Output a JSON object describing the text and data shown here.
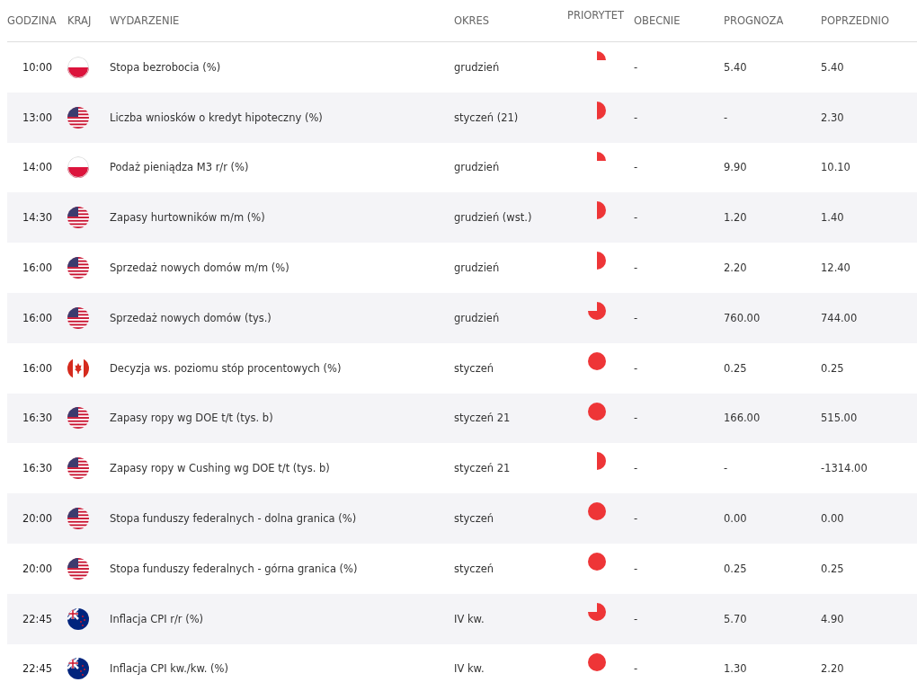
{
  "table": {
    "columns": [
      "GODZINA",
      "KRAJ",
      "WYDARZENIE",
      "OKRES",
      "PRIORYTET",
      "OBECNIE",
      "PROGNOZA",
      "POPRZEDNIO"
    ],
    "rows": [
      {
        "time": "10:00",
        "country": {
          "kind": "pl"
        },
        "event": "Stopa bezrobocia (%)",
        "period": "grudzień",
        "priority": {
          "kind": "quarter"
        },
        "actual": "-",
        "forecast": "5.40",
        "previous": "5.40"
      },
      {
        "time": "13:00",
        "country": {
          "kind": "us"
        },
        "event": "Liczba wniosków o kredyt hipoteczny (%)",
        "period": "styczeń (21)",
        "priority": {
          "kind": "half"
        },
        "actual": "-",
        "forecast": "-",
        "previous": "2.30"
      },
      {
        "time": "14:00",
        "country": {
          "kind": "pl"
        },
        "event": "Podaż pieniądza M3 r/r (%)",
        "period": "grudzień",
        "priority": {
          "kind": "quarter"
        },
        "actual": "-",
        "forecast": "9.90",
        "previous": "10.10"
      },
      {
        "time": "14:30",
        "country": {
          "kind": "us"
        },
        "event": "Zapasy hurtowników m/m (%)",
        "period": "grudzień (wst.)",
        "priority": {
          "kind": "half"
        },
        "actual": "-",
        "forecast": "1.20",
        "previous": "1.40"
      },
      {
        "time": "16:00",
        "country": {
          "kind": "us"
        },
        "event": "Sprzedaż nowych domów m/m (%)",
        "period": "grudzień",
        "priority": {
          "kind": "half"
        },
        "actual": "-",
        "forecast": "2.20",
        "previous": "12.40"
      },
      {
        "time": "16:00",
        "country": {
          "kind": "us"
        },
        "event": "Sprzedaż nowych domów (tys.)",
        "period": "grudzień",
        "priority": {
          "kind": "three-quarters"
        },
        "actual": "-",
        "forecast": "760.00",
        "previous": "744.00"
      },
      {
        "time": "16:00",
        "country": {
          "kind": "ca"
        },
        "event": "Decyzja ws. poziomu stóp procentowych (%)",
        "period": "styczeń",
        "priority": {
          "kind": "full"
        },
        "actual": "-",
        "forecast": "0.25",
        "previous": "0.25"
      },
      {
        "time": "16:30",
        "country": {
          "kind": "us"
        },
        "event": "Zapasy ropy wg DOE t/t (tys. b)",
        "period": "styczeń 21",
        "priority": {
          "kind": "full"
        },
        "actual": "-",
        "forecast": "166.00",
        "previous": "515.00"
      },
      {
        "time": "16:30",
        "country": {
          "kind": "us"
        },
        "event": "Zapasy ropy w Cushing wg DOE t/t (tys. b)",
        "period": "styczeń 21",
        "priority": {
          "kind": "half"
        },
        "actual": "-",
        "forecast": "-",
        "previous": "-1314.00"
      },
      {
        "time": "20:00",
        "country": {
          "kind": "us"
        },
        "event": "Stopa funduszy federalnych - dolna granica (%)",
        "period": "styczeń",
        "priority": {
          "kind": "full"
        },
        "actual": "-",
        "forecast": "0.00",
        "previous": "0.00"
      },
      {
        "time": "20:00",
        "country": {
          "kind": "us"
        },
        "event": "Stopa funduszy federalnych - górna granica (%)",
        "period": "styczeń",
        "priority": {
          "kind": "full"
        },
        "actual": "-",
        "forecast": "0.25",
        "previous": "0.25"
      },
      {
        "time": "22:45",
        "country": {
          "kind": "nz"
        },
        "event": "Inflacja CPI r/r (%)",
        "period": "IV kw.",
        "priority": {
          "kind": "three-quarters"
        },
        "actual": "-",
        "forecast": "5.70",
        "previous": "4.90"
      },
      {
        "time": "22:45",
        "country": {
          "kind": "nz"
        },
        "event": "Inflacja CPI kw./kw. (%)",
        "period": "IV kw.",
        "priority": {
          "kind": "full"
        },
        "actual": "-",
        "forecast": "1.30",
        "previous": "2.20"
      }
    ]
  }
}
